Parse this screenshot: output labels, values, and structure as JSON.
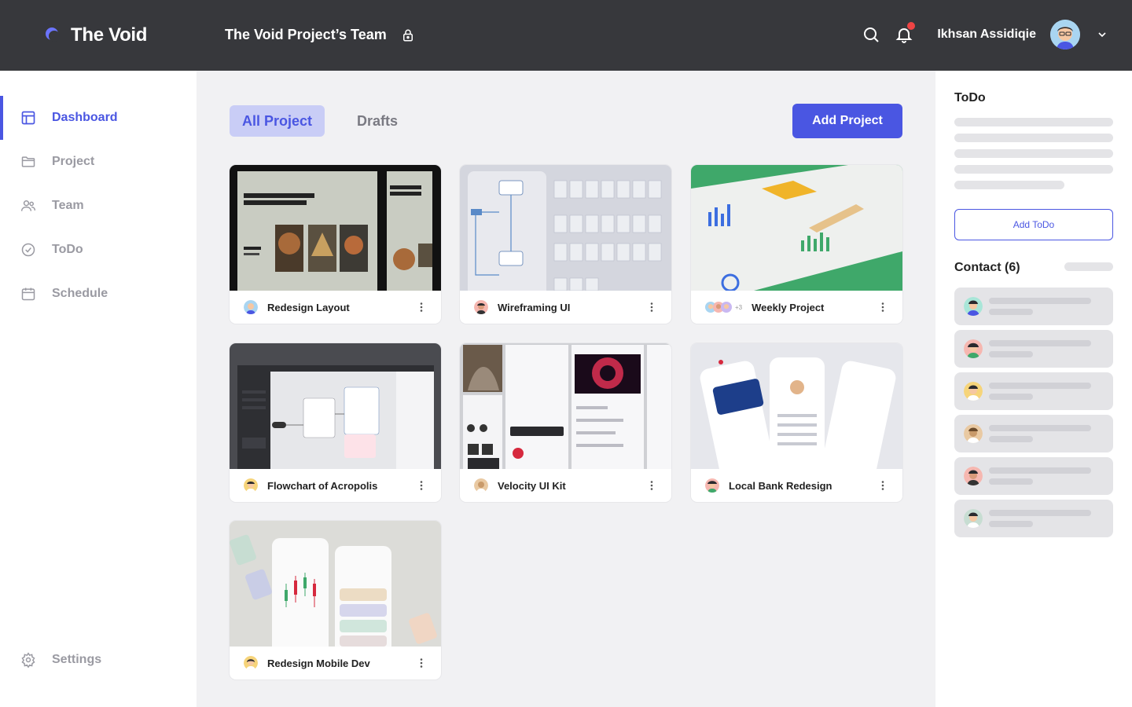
{
  "app": {
    "name": "The Void"
  },
  "header": {
    "team_name": "The Void Project’s Team",
    "user_name": "Ikhsan Assidiqie"
  },
  "sidebar": {
    "items": [
      {
        "label": "Dashboard",
        "icon": "dashboard-icon",
        "active": true
      },
      {
        "label": "Project",
        "icon": "folder-icon"
      },
      {
        "label": "Team",
        "icon": "team-icon"
      },
      {
        "label": "ToDo",
        "icon": "check-circle-icon"
      },
      {
        "label": "Schedule",
        "icon": "calendar-icon"
      }
    ],
    "settings_label": "Settings"
  },
  "main": {
    "tabs": [
      {
        "label": "All Project",
        "active": true
      },
      {
        "label": "Drafts"
      }
    ],
    "add_project_label": "Add Project",
    "projects": [
      {
        "title": "Redesign Layout"
      },
      {
        "title": "Wireframing UI"
      },
      {
        "title": "Weekly Project",
        "extra_members": "+3"
      },
      {
        "title": "Flowchart of Acropolis"
      },
      {
        "title": "Velocity UI Kit"
      },
      {
        "title": "Local Bank Redesign"
      },
      {
        "title": "Redesign Mobile Dev"
      }
    ]
  },
  "right_panel": {
    "todo_title": "ToDo",
    "add_todo_label": "Add ToDo",
    "contact_title": "Contact (6)"
  },
  "colors": {
    "accent": "#4a56e2",
    "topbar": "#37383c",
    "notification": "#ef4444"
  }
}
